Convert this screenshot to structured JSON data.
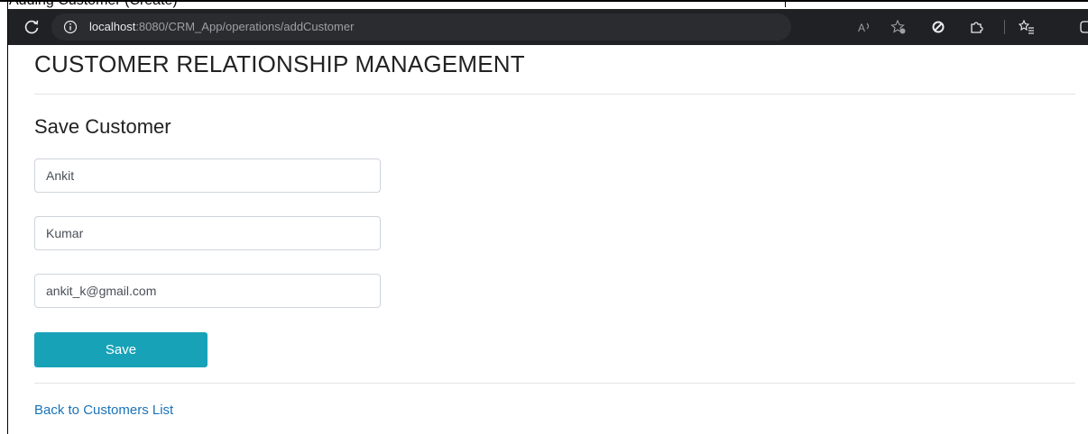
{
  "document": {
    "caption": "Adding Customer (Create)"
  },
  "browser": {
    "url_host": "localhost",
    "url_path": ":8080/CRM_App/operations/addCustomer"
  },
  "page": {
    "app_title": "CUSTOMER RELATIONSHIP MANAGEMENT",
    "section_title": "Save Customer",
    "form": {
      "first_name": "Ankit",
      "last_name": "Kumar",
      "email": "ankit_k@gmail.com",
      "save_label": "Save"
    },
    "back_link": "Back to Customers List"
  },
  "colors": {
    "accent": "#17a2b8",
    "link": "#1a73b8",
    "browser_bar": "#202124"
  }
}
